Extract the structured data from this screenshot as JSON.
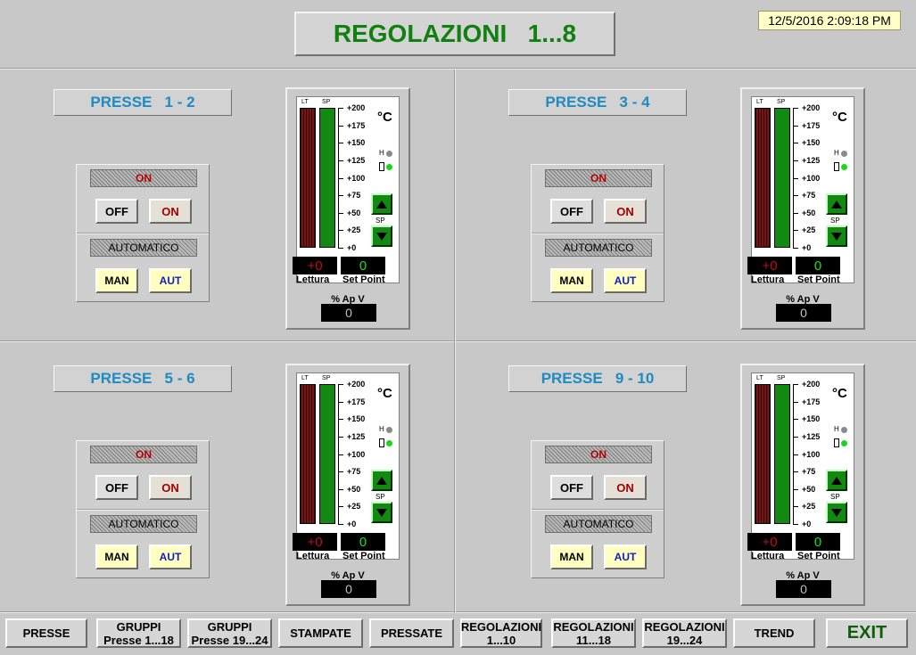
{
  "header": {
    "title": "REGOLAZIONI   1...8",
    "datetime": "12/5/2016 2:09:18 PM"
  },
  "colors": {
    "title_green": "#108010",
    "label_blue": "#1e8bc3",
    "on_red": "#b00000",
    "setpoint_bar": "#128a12",
    "reading_bar": "#5a0b0b"
  },
  "gauge_scale": {
    "unit": "°C",
    "ticks": [
      "+200",
      "+175",
      "+150",
      "+125",
      "+100",
      "+75",
      "+50",
      "+25",
      "+0"
    ],
    "bar_label_lt": "LT",
    "bar_label_sp": "SP",
    "h_label": "H",
    "sp_arrow_label": "SP",
    "reading_caption": "Lettura",
    "setpoint_caption": "Set Point",
    "output_caption": "% Ap V"
  },
  "panels": [
    {
      "label": "PRESSE   1 - 2",
      "status": "ON",
      "mode": "AUTOMATICO",
      "off_label": "OFF",
      "on_label": "ON",
      "man_label": "MAN",
      "aut_label": "AUT",
      "reading": "+0",
      "setpoint": "0",
      "valve_open": "0",
      "high_alarm_icon": "gray-dot",
      "low_alarm_icon": "green-dot"
    },
    {
      "label": "PRESSE   3 - 4",
      "status": "ON",
      "mode": "AUTOMATICO",
      "off_label": "OFF",
      "on_label": "ON",
      "man_label": "MAN",
      "aut_label": "AUT",
      "reading": "+0",
      "setpoint": "0",
      "valve_open": "0",
      "high_alarm_icon": "gray-dot",
      "low_alarm_icon": "green-dot"
    },
    {
      "label": "PRESSE   5 - 6",
      "status": "ON",
      "mode": "AUTOMATICO",
      "off_label": "OFF",
      "on_label": "ON",
      "man_label": "MAN",
      "aut_label": "AUT",
      "reading": "+0",
      "setpoint": "0",
      "valve_open": "0",
      "high_alarm_icon": "gray-dot",
      "low_alarm_icon": "green-dot"
    },
    {
      "label": "PRESSE   9 - 10",
      "status": "ON",
      "mode": "AUTOMATICO",
      "off_label": "OFF",
      "on_label": "ON",
      "man_label": "MAN",
      "aut_label": "AUT",
      "reading": "+0",
      "setpoint": "0",
      "valve_open": "0",
      "high_alarm_icon": "gray-dot",
      "low_alarm_icon": "green-dot"
    }
  ],
  "navbar": [
    {
      "line1": "PRESSE",
      "line2": ""
    },
    {
      "line1": "GRUPPI",
      "line2": "Presse 1...18"
    },
    {
      "line1": "GRUPPI",
      "line2": "Presse 19...24"
    },
    {
      "line1": "STAMPATE",
      "line2": ""
    },
    {
      "line1": "PRESSATE",
      "line2": ""
    },
    {
      "line1": "REGOLAZIONI",
      "line2": "1...10"
    },
    {
      "line1": "REGOLAZIONI",
      "line2": "11...18"
    },
    {
      "line1": "REGOLAZIONI",
      "line2": "19...24"
    },
    {
      "line1": "TREND",
      "line2": ""
    },
    {
      "line1": "EXIT",
      "line2": ""
    }
  ]
}
